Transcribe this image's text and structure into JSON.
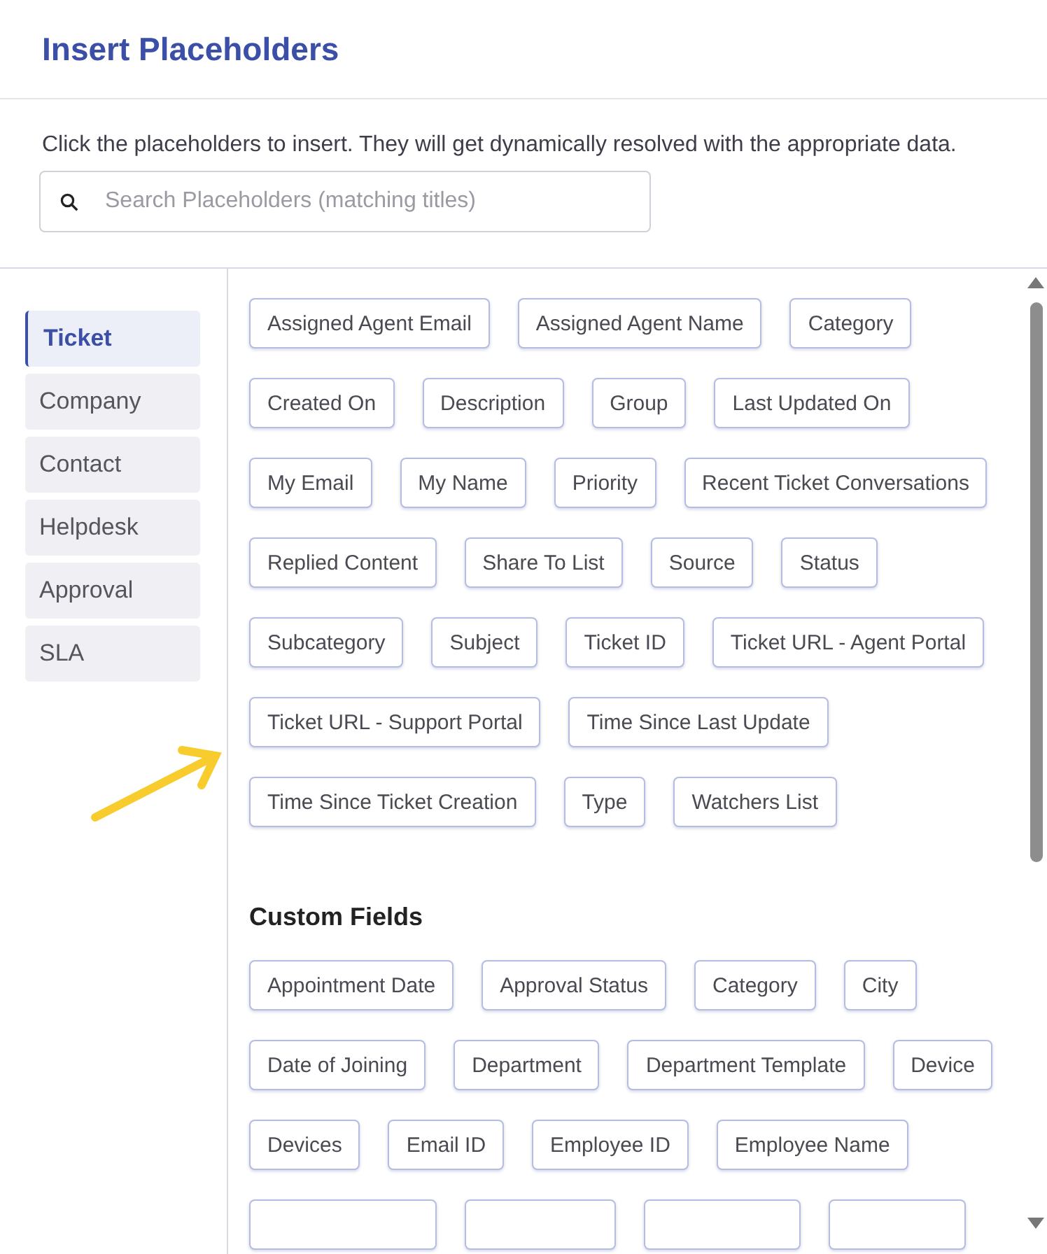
{
  "title": "Insert Placeholders",
  "description": "Click the placeholders to insert. They will get dynamically resolved with the appropriate data.",
  "search": {
    "placeholder": "Search Placeholders (matching titles)"
  },
  "sidebar": {
    "items": [
      {
        "label": "Ticket",
        "selected": true
      },
      {
        "label": "Company",
        "selected": false
      },
      {
        "label": "Contact",
        "selected": false
      },
      {
        "label": "Helpdesk",
        "selected": false
      },
      {
        "label": "Approval",
        "selected": false
      },
      {
        "label": "SLA",
        "selected": false
      }
    ]
  },
  "placeholders": [
    "Assigned Agent Email",
    "Assigned Agent Name",
    "Category",
    "Created On",
    "Description",
    "Group",
    "Last Updated On",
    "My Email",
    "My Name",
    "Priority",
    "Recent Ticket Conversations",
    "Replied Content",
    "Share To List",
    "Source",
    "Status",
    "Subcategory",
    "Subject",
    "Ticket ID",
    "Ticket URL - Agent Portal",
    "Ticket URL - Support Portal",
    "Time Since Last Update",
    "Time Since Ticket Creation",
    "Type",
    "Watchers List"
  ],
  "custom_fields": {
    "title": "Custom Fields",
    "placeholders": [
      "Appointment Date",
      "Approval Status",
      "Category",
      "City",
      "Date of Joining",
      "Department",
      "Department Template",
      "Device",
      "Devices",
      "Email ID",
      "Employee ID",
      "Employee Name"
    ],
    "cut_off_chips": [
      {
        "kind": "chip"
      },
      {
        "kind": "chip"
      },
      {
        "kind": "chip"
      },
      {
        "kind": "chip"
      }
    ]
  }
}
